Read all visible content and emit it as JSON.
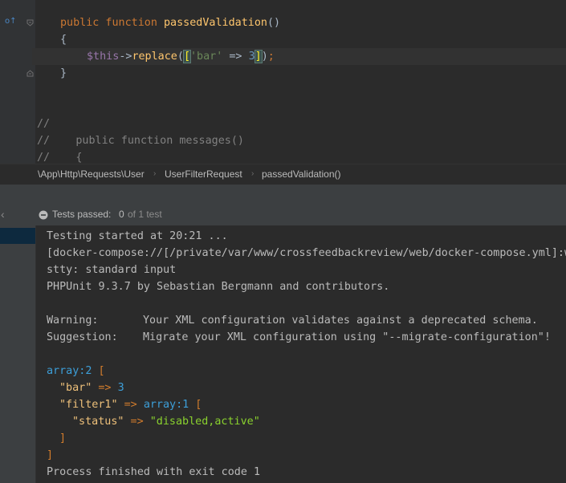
{
  "editor": {
    "line_fn_kw": "public function",
    "line_fn_name": "passedValidation",
    "line_fn_parens": "()",
    "brace_open": "{",
    "stmt_var": "$this",
    "stmt_arrow": "->",
    "stmt_method": "replace",
    "stmt_paren_open": "(",
    "stmt_bracket_open": "[",
    "stmt_key": "'bar'",
    "stmt_op": " => ",
    "stmt_num": "3",
    "stmt_bracket_close": "]",
    "stmt_paren_close": ")",
    "stmt_semicolon": ";",
    "brace_close": "}",
    "comment1": "//",
    "comment2_prefix": "//",
    "comment2_code": "    public function messages()",
    "comment3_prefix": "//",
    "comment3_code": "    {"
  },
  "breadcrumb": {
    "part1": "\\App\\Http\\Requests\\User",
    "part2": "UserFilterRequest",
    "part3": "passedValidation()",
    "separator": "›"
  },
  "run": {
    "status_label": "Tests passed:",
    "passed_count": "0",
    "total_text": "of 1 test",
    "back_glyph": "‹"
  },
  "console": {
    "line1": "Testing started at 20:21 ...",
    "line2": "[docker-compose://[/private/var/www/crossfeedbackreview/web/docker-compose.yml]:w",
    "line3": "stty: standard input",
    "line4": "PHPUnit 9.3.7 by Sebastian Bergmann and contributors.",
    "warning_label": "Warning:",
    "warning_text": "Your XML configuration validates against a deprecated schema.",
    "suggestion_label": "Suggestion:",
    "suggestion_text": "Migrate your XML configuration using \"--migrate-configuration\"!",
    "dump_array": "array:2",
    "dump_open": " [",
    "dump_bar_key": "\"bar\"",
    "dump_arrow": " => ",
    "dump_bar_val": "3",
    "dump_filter_key": "\"filter1\"",
    "dump_filter_arr": "array:1",
    "dump_status_key": "\"status\"",
    "dump_status_val": "\"disabled,active\"",
    "dump_close_inner": "]",
    "dump_close_outer": "]",
    "exit_line": "Process finished with exit code 1"
  },
  "colors": {
    "editor_bg": "#2b2b2b",
    "keyword": "#cc7832",
    "function": "#ffc66d",
    "variable": "#9876aa",
    "string": "#6a8759",
    "number": "#6897bb",
    "comment": "#808080"
  },
  "icons": {
    "gutter_marker": "implements-method-icon",
    "fold": "fold-marker-icon",
    "status": "test-status-circle-icon"
  }
}
